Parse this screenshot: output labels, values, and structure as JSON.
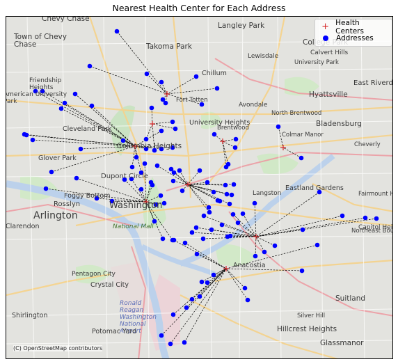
{
  "title": "Nearest Health Center for Each Address",
  "legend": {
    "health_centers": "Health Centers",
    "addresses": "Addresses"
  },
  "attribution": "(C) OpenStreetMap contributors",
  "colors": {
    "health_center": "#d62728",
    "address": "#0000ff",
    "connector": "#000000"
  },
  "place_labels": [
    "Chevy Chase",
    "Town of Chevy Chase",
    "Takoma Park",
    "Langley Park",
    "College Park",
    "Calvert Hills",
    "Lewisdale",
    "University Park",
    "Friendship Heights",
    "American University Park",
    "Chillum",
    "Fort Totten",
    "Hyattsville",
    "East Riverdale",
    "Cleveland Park",
    "University Heights",
    "Avondale",
    "North Brentwood",
    "Bladensburg",
    "Brentwood",
    "Colmar Manor",
    "Cheverly",
    "Columbia Heights",
    "Glover Park",
    "Dupont Circle",
    "Foggy Bottom",
    "Rosslyn",
    "Washington",
    "Langston",
    "Eastland Gardens",
    "Fairmount Heights",
    "Arlington",
    "National Mall",
    "Northeast Boundary",
    "Capitol Heights",
    "Clarendon",
    "Pentagon City",
    "Crystal City",
    "Anacostia",
    "Suitland",
    "Ronald Reagan Washington National Airport",
    "Shirlington",
    "Silver Hill",
    "Hillcrest Heights",
    "Potomac Yard",
    "Glassmanor"
  ]
}
